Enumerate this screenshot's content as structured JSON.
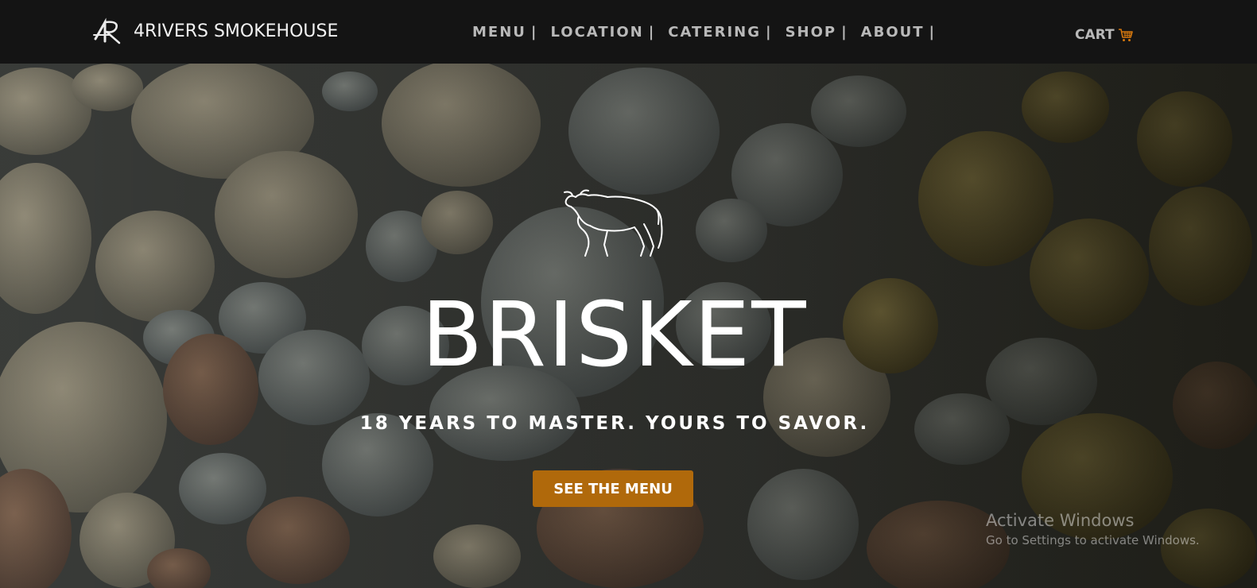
{
  "header": {
    "brand_name": "4RIVERS SMOKEHOUSE",
    "nav": [
      {
        "label": "MENU",
        "sep": "|"
      },
      {
        "label": "LOCATION",
        "sep": "|"
      },
      {
        "label": "CATERING",
        "sep": "|"
      },
      {
        "label": "SHOP",
        "sep": "|"
      },
      {
        "label": "ABOUT",
        "sep": "|"
      }
    ],
    "cart_label": "CART",
    "cart_icon": "shopping-cart-icon"
  },
  "hero": {
    "emblem_icon": "bull-icon",
    "title": "BRISKET",
    "tagline": "18 YEARS TO MASTER. YOURS TO SAVOR.",
    "cta_label": "SEE THE MENU"
  },
  "watermark": {
    "title": "Activate Windows",
    "subtitle": "Go to Settings to activate Windows."
  },
  "colors": {
    "nav_bg": "#141414",
    "nav_text": "#b9b9b9",
    "cta_bg": "#b0690b",
    "cart_icon": "#d4770e"
  }
}
